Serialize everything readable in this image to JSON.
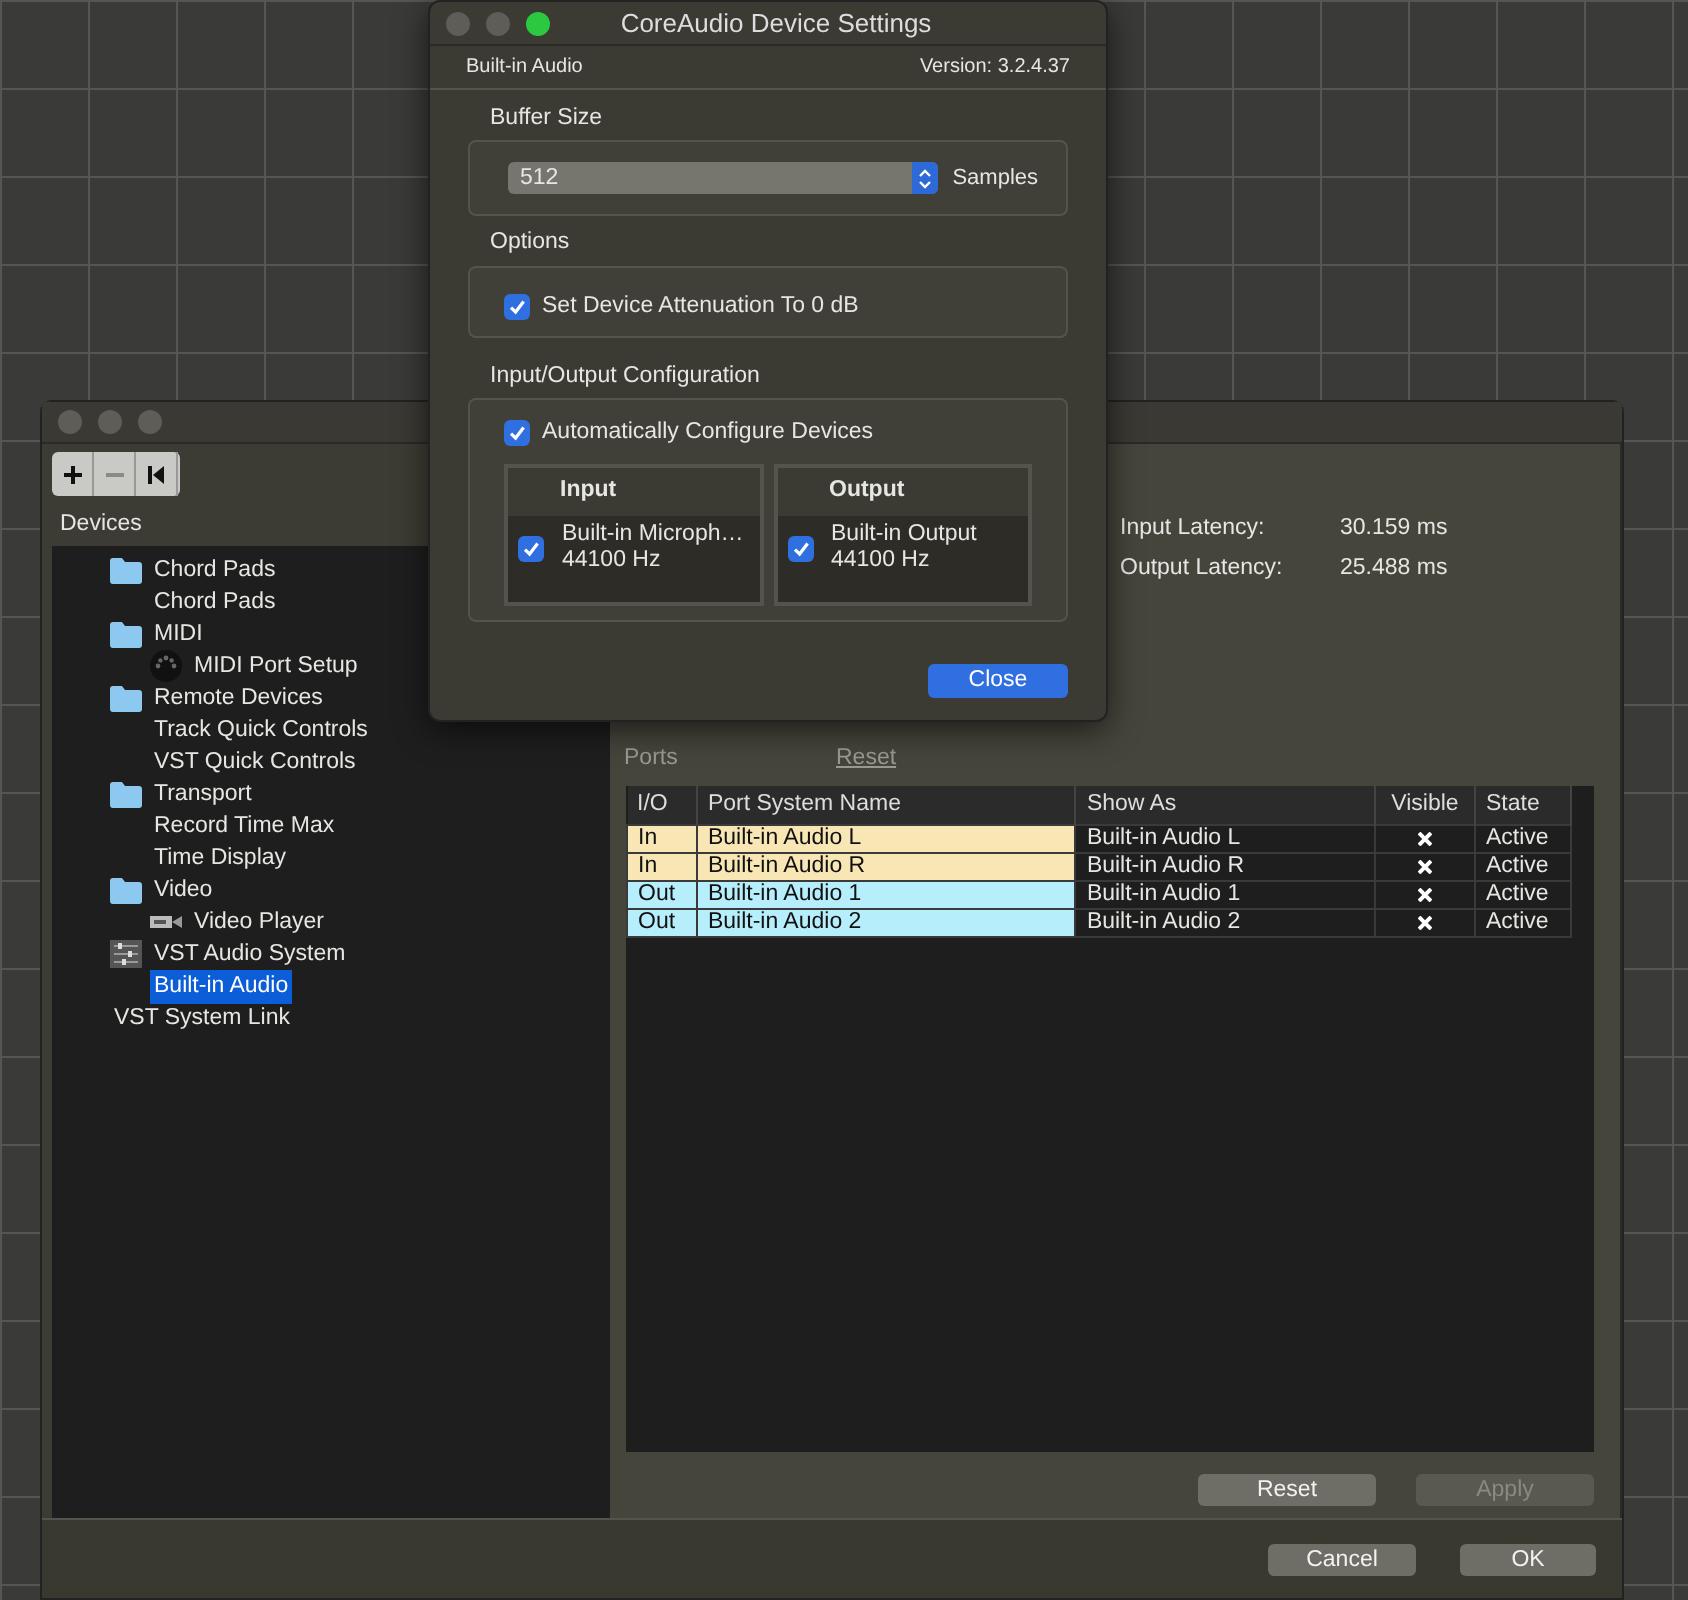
{
  "dialog": {
    "title": "CoreAudio Device Settings",
    "device": "Built-in Audio",
    "version": "Version: 3.2.4.37",
    "buffer_size": {
      "label": "Buffer Size",
      "value": "512",
      "unit": "Samples"
    },
    "options": {
      "label": "Options",
      "items": [
        {
          "label": "Set Device Attenuation To 0 dB",
          "checked": true
        }
      ]
    },
    "io_config": {
      "label": "Input/Output Configuration",
      "auto": {
        "label": "Automatically Configure Devices",
        "checked": true
      },
      "lists": [
        {
          "header": "Input",
          "items": [
            {
              "name": "Built-in Microph…",
              "rate": "44100 Hz",
              "checked": true
            }
          ]
        },
        {
          "header": "Output",
          "items": [
            {
              "name": "Built-in Output",
              "rate": "44100 Hz",
              "checked": true
            }
          ]
        }
      ]
    },
    "close_button": "Close"
  },
  "main_window": {
    "toolbar": [
      {
        "kind": "add",
        "disabled": false
      },
      {
        "kind": "remove",
        "disabled": true
      },
      {
        "kind": "first",
        "disabled": false
      }
    ],
    "devices_label": "Devices",
    "tree": [
      {
        "label": "Chord Pads",
        "kind": "folder",
        "selected": false,
        "children": [
          {
            "label": "Chord Pads",
            "kind": "plain",
            "selected": false
          }
        ]
      },
      {
        "label": "MIDI",
        "kind": "folder",
        "selected": false,
        "children": [
          {
            "label": "MIDI Port Setup",
            "kind": "midi",
            "selected": false
          }
        ]
      },
      {
        "label": "Remote Devices",
        "kind": "folder",
        "selected": false,
        "children": [
          {
            "label": "Track Quick Controls",
            "kind": "plain",
            "selected": false
          },
          {
            "label": "VST Quick Controls",
            "kind": "plain",
            "selected": false
          }
        ]
      },
      {
        "label": "Transport",
        "kind": "folder",
        "selected": false,
        "children": [
          {
            "label": "Record Time Max",
            "kind": "plain",
            "selected": false
          },
          {
            "label": "Time Display",
            "kind": "plain",
            "selected": false
          }
        ]
      },
      {
        "label": "Video",
        "kind": "folder",
        "selected": false,
        "children": [
          {
            "label": "Video Player",
            "kind": "video",
            "selected": false
          }
        ]
      },
      {
        "label": "VST Audio System",
        "kind": "audio",
        "selected": false,
        "children": [
          {
            "label": "Built-in Audio",
            "kind": "plain",
            "selected": true
          }
        ]
      },
      {
        "label": "VST System Link",
        "kind": "plain",
        "selected": false
      }
    ],
    "latency": [
      {
        "label": "Input Latency:",
        "value": "30.159 ms"
      },
      {
        "label": "Output Latency:",
        "value": "25.488 ms"
      }
    ],
    "ports": {
      "label": "Ports",
      "reset_link": "Reset",
      "columns": [
        "I/O",
        "Port System Name",
        "Show As",
        "Visible",
        "State"
      ],
      "rows": [
        {
          "io": "In",
          "port_system_name": "Built-in Audio L",
          "show_as": "Built-in Audio L",
          "visible": true,
          "state": "Active",
          "color": "#f8e6b4"
        },
        {
          "io": "In",
          "port_system_name": "Built-in Audio R",
          "show_as": "Built-in Audio R",
          "visible": true,
          "state": "Active",
          "color": "#f8e6b4"
        },
        {
          "io": "Out",
          "port_system_name": "Built-in Audio 1",
          "show_as": "Built-in Audio 1",
          "visible": true,
          "state": "Active",
          "color": "#b6eefb"
        },
        {
          "io": "Out",
          "port_system_name": "Built-in Audio 2",
          "show_as": "Built-in Audio 2",
          "visible": true,
          "state": "Active",
          "color": "#b6eefb"
        }
      ]
    },
    "buttons": [
      {
        "label": "Reset",
        "disabled": false
      },
      {
        "label": "Apply",
        "disabled": true
      }
    ],
    "footer_buttons": [
      {
        "label": "Cancel"
      },
      {
        "label": "OK"
      }
    ]
  }
}
